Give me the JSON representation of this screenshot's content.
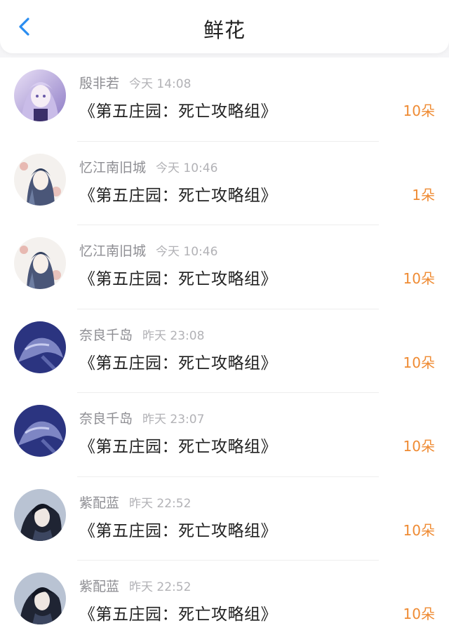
{
  "header": {
    "title": "鲜花",
    "back_icon": "chevron-left-icon",
    "accent": "#2a8df0"
  },
  "colors": {
    "count": "#ef8b33",
    "name": "#8e8e93",
    "time": "#b2b2b6"
  },
  "records": [
    {
      "user": "殷非若",
      "time": "今天 14:08",
      "book": "《第五庄园：死亡攻略组》",
      "count": "10朵",
      "avatar": "lavender-anime"
    },
    {
      "user": "忆江南旧城",
      "time": "今天 10:46",
      "book": "《第五庄园：死亡攻略组》",
      "count": "1朵",
      "avatar": "flower-girl"
    },
    {
      "user": "忆江南旧城",
      "time": "今天 10:46",
      "book": "《第五庄园：死亡攻略组》",
      "count": "10朵",
      "avatar": "flower-girl"
    },
    {
      "user": "奈良千岛",
      "time": "昨天 23:08",
      "book": "《第五庄园：死亡攻略组》",
      "count": "10朵",
      "avatar": "blue-dragon"
    },
    {
      "user": "奈良千岛",
      "time": "昨天 23:07",
      "book": "《第五庄园：死亡攻略组》",
      "count": "10朵",
      "avatar": "blue-dragon"
    },
    {
      "user": "紫配蓝",
      "time": "昨天 22:52",
      "book": "《第五庄园：死亡攻略组》",
      "count": "10朵",
      "avatar": "dark-hair-man"
    },
    {
      "user": "紫配蓝",
      "time": "昨天 22:52",
      "book": "《第五庄园：死亡攻略组》",
      "count": "10朵",
      "avatar": "dark-hair-man"
    }
  ]
}
